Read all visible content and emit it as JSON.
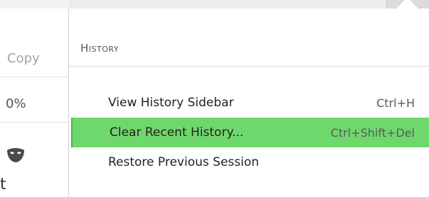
{
  "menu": {
    "header": "History",
    "items": [
      {
        "label": "View History Sidebar",
        "shortcut": "Ctrl+H",
        "highlighted": false
      },
      {
        "label": "Clear Recent History...",
        "shortcut": "Ctrl+Shift+Del",
        "highlighted": true
      },
      {
        "label": "Restore Previous Session",
        "shortcut": "",
        "highlighted": false
      }
    ]
  },
  "background_panel": {
    "copy_label": "Copy",
    "zoom_value": "0%",
    "tail_text": "t"
  },
  "colors": {
    "highlight": "#6fd86c",
    "highlight_border": "#4fb14c"
  }
}
